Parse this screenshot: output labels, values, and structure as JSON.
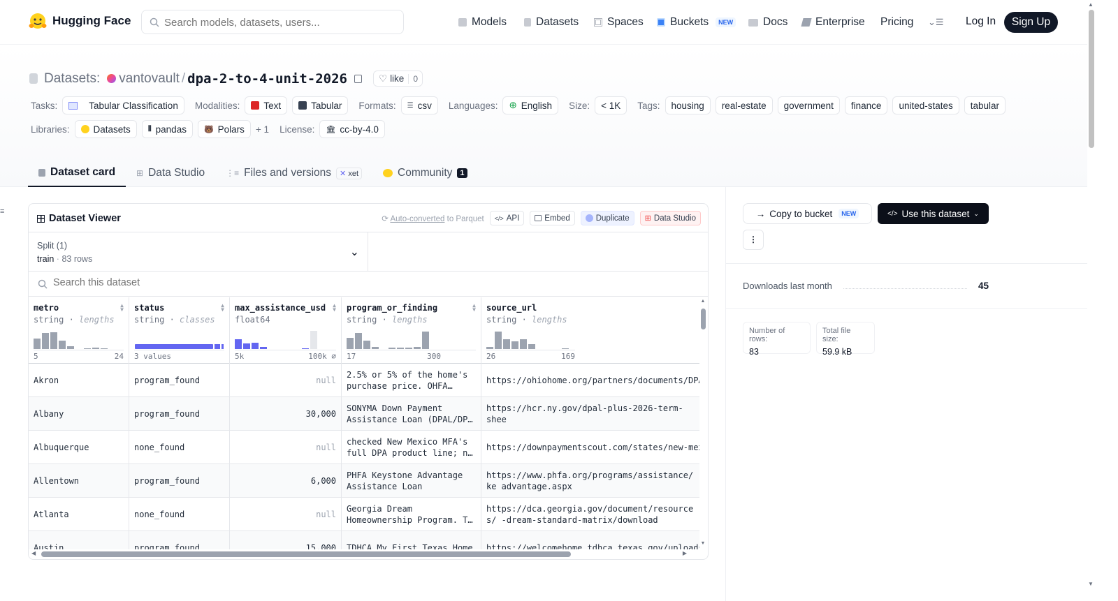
{
  "nav": {
    "brand": "Hugging Face",
    "search_placeholder": "Search models, datasets, users...",
    "models": "Models",
    "datasets": "Datasets",
    "spaces": "Spaces",
    "buckets": "Buckets",
    "new_badge": "NEW",
    "docs": "Docs",
    "enterprise": "Enterprise",
    "pricing": "Pricing",
    "login": "Log In",
    "signup": "Sign Up"
  },
  "header": {
    "prefix": "Datasets:",
    "owner": "vantovault",
    "sep": "/",
    "name": "dpa-2-to-4-unit-2026",
    "like": "like",
    "like_count": "0"
  },
  "meta": {
    "tasks_label": "Tasks:",
    "task": "Tabular Classification",
    "modalities_label": "Modalities:",
    "mod_text": "Text",
    "mod_tabular": "Tabular",
    "formats_label": "Formats:",
    "format": "csv",
    "languages_label": "Languages:",
    "language": "English",
    "size_label": "Size:",
    "size": "< 1K",
    "tags_label": "Tags:",
    "tags": [
      "housing",
      "real-estate",
      "government",
      "finance",
      "united-states",
      "tabular"
    ],
    "libraries_label": "Libraries:",
    "lib_datasets": "Datasets",
    "lib_pandas": "pandas",
    "lib_polars": "Polars",
    "lib_more": "+ 1",
    "license_label": "License:",
    "license": "cc-by-4.0"
  },
  "tabs": {
    "card": "Dataset card",
    "studio": "Data Studio",
    "files": "Files and versions",
    "xet": "xet",
    "community": "Community",
    "community_count": "1"
  },
  "viewer": {
    "title": "Dataset Viewer",
    "autoconv": "Auto-converted",
    "autoconv_tail": " to Parquet",
    "api": "API",
    "embed": "Embed",
    "duplicate": "Duplicate",
    "studio": "Data Studio",
    "split_label": "Split (1)",
    "split": "train",
    "rows": "83 rows",
    "search_placeholder": "Search this dataset"
  },
  "columns": [
    {
      "name": "metro",
      "type": "string",
      "stat": "lengths",
      "min": "5",
      "max": "24"
    },
    {
      "name": "status",
      "type": "string",
      "stat": "classes",
      "min": "3 values",
      "max": ""
    },
    {
      "name": "max_assistance_usd",
      "type": "float64",
      "stat": "",
      "min": "5k",
      "max": "100k ⌀"
    },
    {
      "name": "program_or_finding",
      "type": "string",
      "stat": "lengths",
      "min": "17",
      "max": "300"
    },
    {
      "name": "source_url",
      "type": "string",
      "stat": "lengths",
      "min": "26",
      "max": "169"
    }
  ],
  "rows": [
    {
      "metro": "Akron",
      "status": "program_found",
      "max": "null",
      "prog": "2.5% or 5% of the home's purchase price. OHFA…",
      "url": "https://ohiohome.org/partners/documents/DPA"
    },
    {
      "metro": "Albany",
      "status": "program_found",
      "max": "30,000",
      "prog": "SONYMA Down Payment Assistance Loan (DPAL/DP…",
      "url": "https://hcr.ny.gov/dpal-plus-2026-term-shee"
    },
    {
      "metro": "Albuquerque",
      "status": "none_found",
      "max": "null",
      "prog": "checked New Mexico MFA's full DPA product line; n…",
      "url": "https://downpaymentscout.com/states/new-mex"
    },
    {
      "metro": "Allentown",
      "status": "program_found",
      "max": "6,000",
      "prog": "PHFA Keystone Advantage Assistance Loan",
      "url": "https://www.phfa.org/programs/assistance/ke advantage.aspx"
    },
    {
      "metro": "Atlanta",
      "status": "none_found",
      "max": "null",
      "prog": "Georgia Dream Homeownership Program. T…",
      "url": "https://dca.georgia.gov/document/resources/ -dream-standard-matrix/download"
    },
    {
      "metro": "Austin",
      "status": "program_found",
      "max": "15,000",
      "prog": "TDHCA My First Texas Home",
      "url": "https://welcomehome.tdhca.texas.gov/uploads"
    }
  ],
  "sidebar": {
    "copy": "Copy to bucket",
    "new": "NEW",
    "use": "Use this dataset",
    "downloads_label": "Downloads last month",
    "downloads": "45",
    "rows_label": "Number of rows:",
    "rows": "83",
    "size_label": "Total file size:",
    "size": "59.9 kB"
  },
  "colors": {
    "accent": "#6366f1",
    "dark": "#111827",
    "grey": "#9ca3af"
  }
}
